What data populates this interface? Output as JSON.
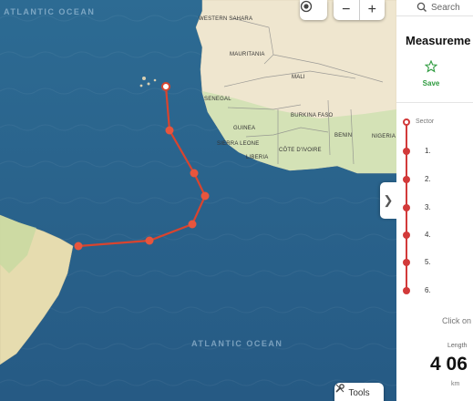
{
  "map": {
    "country_labels": [
      "WESTERN SAHARA",
      "MAURITANIA",
      "MALI",
      "SENEGAL",
      "GUINEA",
      "BURKINA FASO",
      "SIERRA LEONE",
      "CÔTE D'IVOIRE",
      "LIBERIA",
      "BENIN",
      "NIGERIA"
    ],
    "ocean_labels": [
      "ATLANTIC OCEAN",
      "ATLANTIC OCEAN"
    ],
    "route": {
      "color": "#d9442e",
      "vertex_count": 7
    },
    "controls": {
      "locate_icon": "target-icon",
      "zoom_out_label": "−",
      "zoom_in_label": "+",
      "tools_label": "Tools",
      "tools_icon": "wrench-icon",
      "collapse_icon": "chevron-right-icon"
    }
  },
  "panel": {
    "search_placeholder": "Search",
    "title": "Measureme",
    "save_label": "Save",
    "sector_label": "Sector",
    "points": [
      "1.",
      "2.",
      "3.",
      "4.",
      "5.",
      "6."
    ],
    "hint": "Click on",
    "length_label": "Length",
    "length_value": "4 06",
    "length_unit": "km",
    "accent_color": "#d23a3a"
  }
}
